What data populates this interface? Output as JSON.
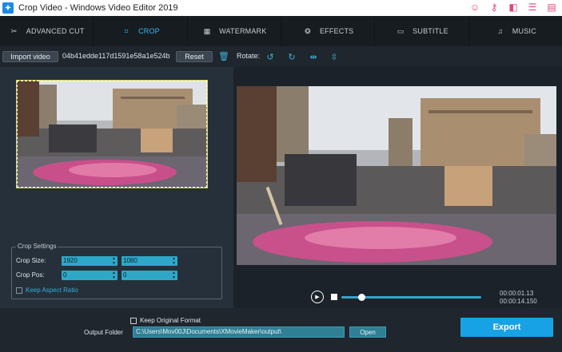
{
  "window": {
    "title": "Crop Video - Windows Video Editor 2019"
  },
  "title_actions": [
    {
      "icon": "face-icon",
      "glyph": "☺"
    },
    {
      "icon": "key-icon",
      "glyph": "⚷"
    },
    {
      "icon": "layout-icon",
      "glyph": "◧"
    },
    {
      "icon": "list-icon",
      "glyph": "☰"
    },
    {
      "icon": "menu-icon",
      "glyph": "▤"
    }
  ],
  "tabs": [
    {
      "label": "ADVANCED CUT",
      "icon": "scissors-icon",
      "glyph": "✂",
      "active": false
    },
    {
      "label": "CROP",
      "icon": "crop-icon",
      "glyph": "⌗",
      "active": true
    },
    {
      "label": "WATERMARK",
      "icon": "watermark-icon",
      "glyph": "▦",
      "active": false
    },
    {
      "label": "EFFECTS",
      "icon": "effects-icon",
      "glyph": "❂",
      "active": false
    },
    {
      "label": "SUBTITLE",
      "icon": "subtitle-icon",
      "glyph": "▭",
      "active": false
    },
    {
      "label": "MUSIC",
      "icon": "music-icon",
      "glyph": "♫",
      "active": false
    }
  ],
  "toolbar": {
    "import_label": "Import video",
    "filename": "04b41edde117d1591e58a1e524b",
    "reset_label": "Reset",
    "rotate_label": "Rotate:"
  },
  "crop_settings": {
    "legend": "Crop Settings",
    "size_label": "Crop Size:",
    "pos_label": "Crop Pos:",
    "width": "1920",
    "height": "1080",
    "pos_x": "0",
    "pos_y": "0",
    "keep_aspect_label": "Keep Aspect Ratio"
  },
  "player": {
    "current_time": "00:00:01.13",
    "total_time": "00:00:14.150",
    "progress": 0.14
  },
  "output": {
    "keep_format_label": "Keep Original Format",
    "folder_label": "Output Folder",
    "folder_path": "C:\\Users\\Mov00J\\Documents\\XMovieMaker\\output\\",
    "open_label": "Open",
    "export_label": "Export"
  },
  "colors": {
    "accent": "#17a2e6",
    "active_tab": "#37b7e8",
    "field": "#2fa8c8"
  }
}
